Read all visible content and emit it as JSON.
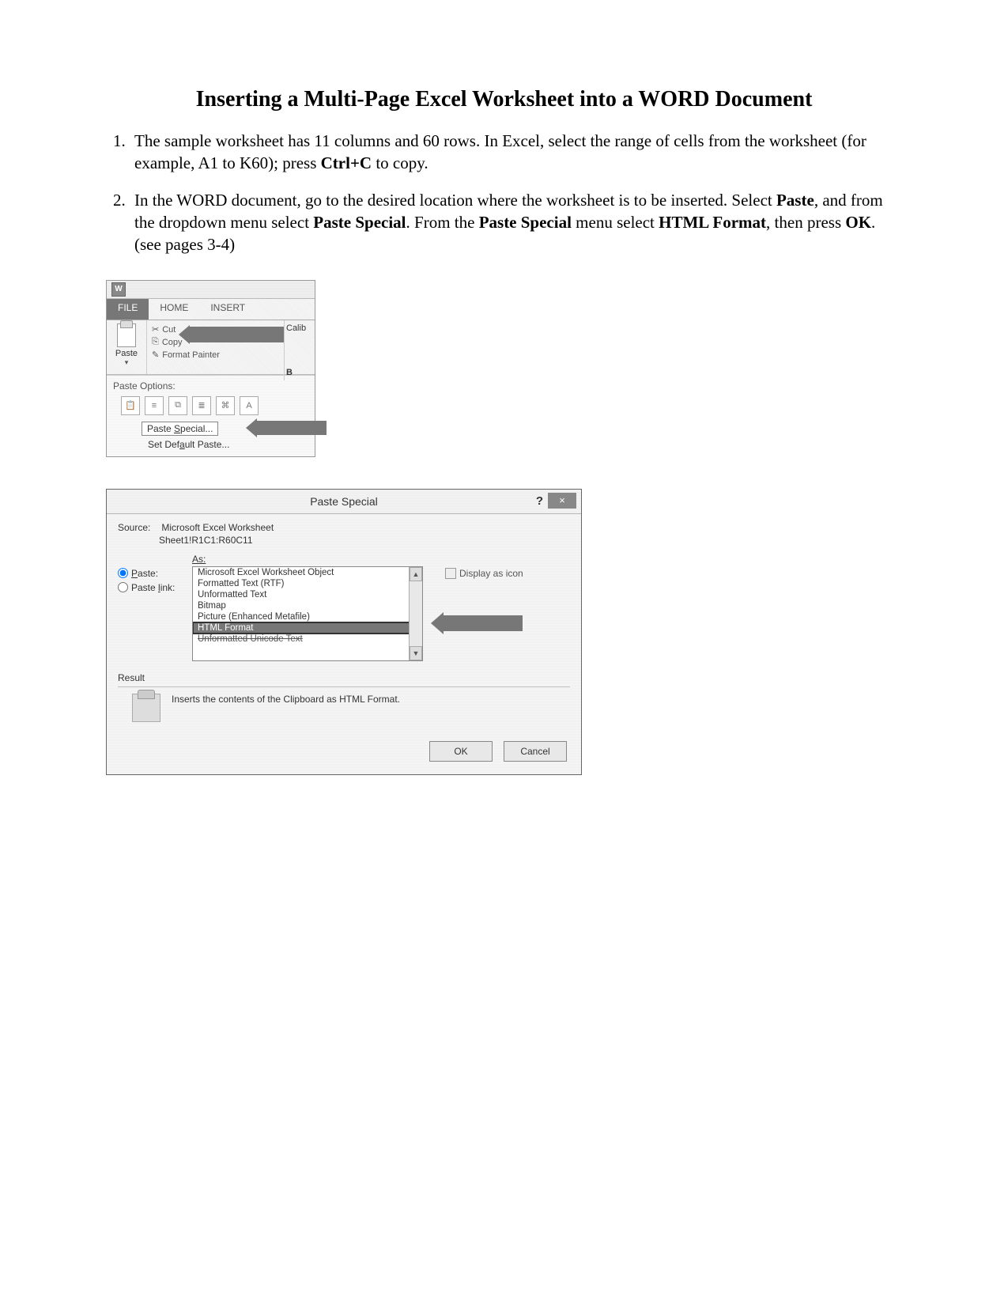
{
  "title": "Inserting a Multi-Page Excel Worksheet into a WORD Document",
  "steps": {
    "s1_a": "The sample worksheet has 11 columns and 60 rows. In Excel, select the range of cells from the worksheet (for example, A1 to K60); press ",
    "s1_b": "Ctrl+C",
    "s1_c": " to copy.",
    "s2_a": "In the WORD document, go to the desired location where the worksheet is to be inserted. Select ",
    "s2_b": "Paste",
    "s2_c": ", and from the dropdown menu select ",
    "s2_d": "Paste Special",
    "s2_e": ". From the ",
    "s2_f": "Paste Special",
    "s2_g": " menu select ",
    "s2_h": "HTML Format",
    "s2_i": ", then press ",
    "s2_j": "OK",
    "s2_k": ". (see pages 3-4)"
  },
  "ribbon": {
    "word_icon": "W",
    "tab_file": "FILE",
    "tab_home": "HOME",
    "tab_insert": "INSERT",
    "paste": "Paste",
    "cut": "Cut",
    "copy": "Copy",
    "format_painter": "Format Painter",
    "calibri": "Calib",
    "bold_b": "B",
    "paste_options": "Paste Options:",
    "paste_special": "Paste Special...",
    "set_default_paste": "Set Default Paste..."
  },
  "dialog": {
    "title": "Paste Special",
    "help": "?",
    "close": "×",
    "source_label": "Source:",
    "source_value": "Microsoft Excel Worksheet",
    "source_ref": "Sheet1!R1C1:R60C11",
    "as_label": "As:",
    "radio_paste": "Paste:",
    "radio_paste_link": "Paste link:",
    "opts": [
      "Microsoft Excel Worksheet Object",
      "Formatted Text (RTF)",
      "Unformatted Text",
      "Bitmap",
      "Picture (Enhanced Metafile)",
      "HTML Format",
      "Unformatted Unicode Text"
    ],
    "display_as_icon": "Display as icon",
    "result_label": "Result",
    "result_text": "Inserts the contents of the Clipboard as HTML Format.",
    "ok": "OK",
    "cancel": "Cancel"
  }
}
